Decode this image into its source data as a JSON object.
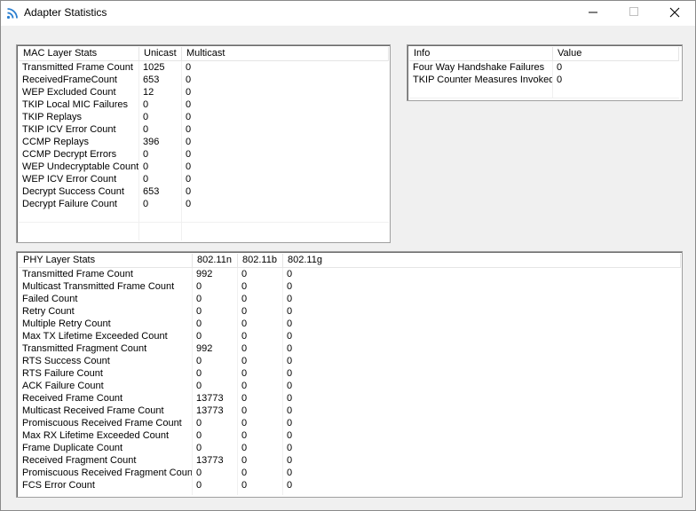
{
  "window": {
    "title": "Adapter Statistics"
  },
  "mac": {
    "headers": [
      "MAC Layer Stats",
      "Unicast",
      "Multicast"
    ],
    "rows": [
      [
        "Transmitted Frame Count",
        "1025",
        "0"
      ],
      [
        "ReceivedFrameCount",
        "653",
        "0"
      ],
      [
        "WEP Excluded Count",
        "12",
        "0"
      ],
      [
        "TKIP Local MIC Failures",
        "0",
        "0"
      ],
      [
        "TKIP Replays",
        "0",
        "0"
      ],
      [
        "TKIP ICV Error Count",
        "0",
        "0"
      ],
      [
        "CCMP Replays",
        "396",
        "0"
      ],
      [
        "CCMP Decrypt Errors",
        "0",
        "0"
      ],
      [
        "WEP Undecryptable Count",
        "0",
        "0"
      ],
      [
        "WEP ICV Error Count",
        "0",
        "0"
      ],
      [
        "Decrypt Success Count",
        "653",
        "0"
      ],
      [
        "Decrypt Failure Count",
        "0",
        "0"
      ]
    ]
  },
  "info": {
    "headers": [
      "Info",
      "Value"
    ],
    "rows": [
      [
        "Four Way Handshake Failures",
        "0"
      ],
      [
        "TKIP Counter Measures Invoked",
        "0"
      ]
    ]
  },
  "phy": {
    "headers": [
      "PHY Layer Stats",
      "802.11n",
      "802.11b",
      "802.11g"
    ],
    "rows": [
      [
        "Transmitted Frame Count",
        "992",
        "0",
        "0"
      ],
      [
        "Multicast Transmitted Frame Count",
        "0",
        "0",
        "0"
      ],
      [
        "Failed Count",
        "0",
        "0",
        "0"
      ],
      [
        "Retry Count",
        "0",
        "0",
        "0"
      ],
      [
        "Multiple Retry Count",
        "0",
        "0",
        "0"
      ],
      [
        "Max TX Lifetime Exceeded Count",
        "0",
        "0",
        "0"
      ],
      [
        "Transmitted Fragment Count",
        "992",
        "0",
        "0"
      ],
      [
        "RTS Success Count",
        "0",
        "0",
        "0"
      ],
      [
        "RTS Failure Count",
        "0",
        "0",
        "0"
      ],
      [
        "ACK Failure Count",
        "0",
        "0",
        "0"
      ],
      [
        "Received Frame Count",
        "13773",
        "0",
        "0"
      ],
      [
        "Multicast Received Frame Count",
        "13773",
        "0",
        "0"
      ],
      [
        "Promiscuous Received Frame Count",
        "0",
        "0",
        "0"
      ],
      [
        "Max RX Lifetime Exceeded Count",
        "0",
        "0",
        "0"
      ],
      [
        "Frame Duplicate Count",
        "0",
        "0",
        "0"
      ],
      [
        "Received Fragment Count",
        "13773",
        "0",
        "0"
      ],
      [
        "Promiscuous Received Fragment Count",
        "0",
        "0",
        "0"
      ],
      [
        "FCS Error Count",
        "0",
        "0",
        "0"
      ]
    ]
  }
}
